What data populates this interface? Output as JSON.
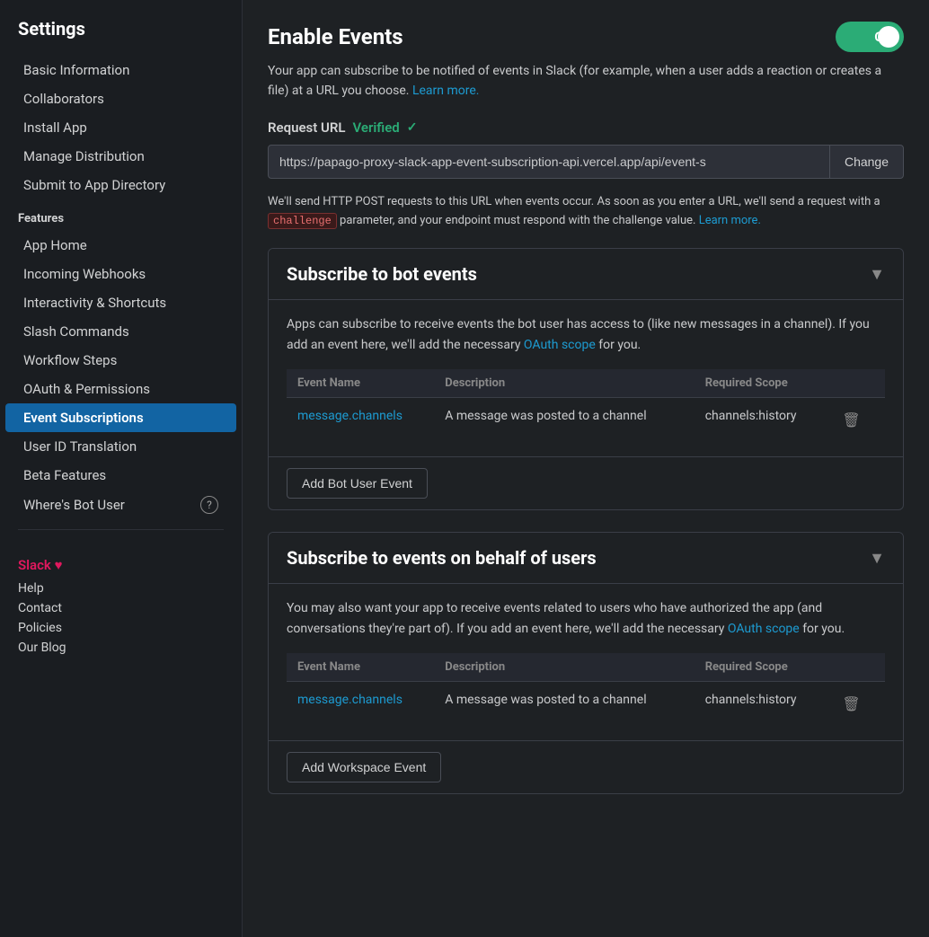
{
  "sidebar": {
    "title": "Settings",
    "settings_items": [
      {
        "id": "basic-information",
        "label": "Basic Information",
        "active": false
      },
      {
        "id": "collaborators",
        "label": "Collaborators",
        "active": false
      },
      {
        "id": "install-app",
        "label": "Install App",
        "active": false
      },
      {
        "id": "manage-distribution",
        "label": "Manage Distribution",
        "active": false
      },
      {
        "id": "submit-to-app-directory",
        "label": "Submit to App Directory",
        "active": false
      }
    ],
    "features_label": "Features",
    "features_items": [
      {
        "id": "app-home",
        "label": "App Home",
        "active": false
      },
      {
        "id": "incoming-webhooks",
        "label": "Incoming Webhooks",
        "active": false
      },
      {
        "id": "interactivity-shortcuts",
        "label": "Interactivity & Shortcuts",
        "active": false
      },
      {
        "id": "slash-commands",
        "label": "Slash Commands",
        "active": false
      },
      {
        "id": "workflow-steps",
        "label": "Workflow Steps",
        "active": false
      },
      {
        "id": "oauth-permissions",
        "label": "OAuth & Permissions",
        "active": false
      },
      {
        "id": "event-subscriptions",
        "label": "Event Subscriptions",
        "active": true
      },
      {
        "id": "user-id-translation",
        "label": "User ID Translation",
        "active": false
      },
      {
        "id": "beta-features",
        "label": "Beta Features",
        "active": false
      },
      {
        "id": "wheres-bot-user",
        "label": "Where's Bot User",
        "active": false,
        "has_help": true
      }
    ],
    "footer": {
      "brand": "Slack ♥",
      "links": [
        "Help",
        "Contact",
        "Policies",
        "Our Blog"
      ]
    }
  },
  "main": {
    "enable_events": {
      "title": "Enable Events",
      "toggle_label": "On",
      "toggle_on": true,
      "description": "Your app can subscribe to be notified of events in Slack (for example, when a user adds a reaction or creates a file) at a URL you choose.",
      "learn_more_text": "Learn more.",
      "request_url_label": "Request URL",
      "verified_label": "Verified",
      "url_value": "https://papago-proxy-slack-app-event-subscription-api.vercel.app/api/event-s",
      "change_btn": "Change",
      "http_note_part1": "We'll send HTTP POST requests to this URL when events occur. As soon as you enter a URL, we'll send a request with a ",
      "challenge_code": "challenge",
      "http_note_part2": " parameter, and your endpoint must respond with the challenge value.",
      "learn_more2": "Learn more."
    },
    "bot_events": {
      "title": "Subscribe to bot events",
      "description_part1": "Apps can subscribe to receive events the bot user has access to (like new messages in a channel). If you add an event here, we'll add the necessary ",
      "oauth_scope_text": "OAuth scope",
      "description_part2": " for you.",
      "columns": [
        "Event Name",
        "Description",
        "Required Scope"
      ],
      "events": [
        {
          "name": "message.channels",
          "description": "A message was posted to a channel",
          "scope": "channels:history"
        }
      ],
      "add_btn_label": "Add Bot User Event"
    },
    "user_events": {
      "title": "Subscribe to events on behalf of users",
      "description_part1": "You may also want your app to receive events related to users who have authorized the app (and conversations they're part of). If you add an event here, we'll add the necessary ",
      "oauth_scope_text": "OAuth scope",
      "description_part2": " for you.",
      "columns": [
        "Event Name",
        "Description",
        "Required Scope"
      ],
      "events": [
        {
          "name": "message.channels",
          "description": "A message was posted to a channel",
          "scope": "channels:history"
        }
      ],
      "add_btn_label": "Add Workspace Event"
    }
  }
}
